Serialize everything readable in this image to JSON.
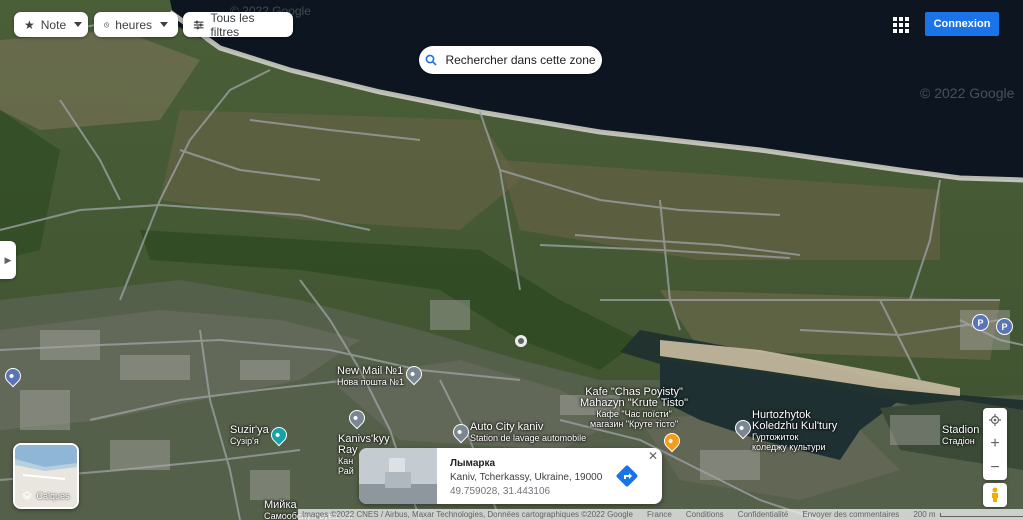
{
  "filters": {
    "note_label": "Note",
    "hours_label": "heures",
    "all_filters_label": "Tous les filtres"
  },
  "search_area_label": "Rechercher dans cette zone",
  "signin_label": "Connexion",
  "watermark": "© 2022 Google",
  "layers_label": "Calques",
  "map_labels": {
    "new_mail": "New Mail №1",
    "new_mail_sub": "Нова пошта №1",
    "kafe_1": "Kafe \"Chas Poyisty\"",
    "kafe_2": "Mahazyn \"Krute Tisto\"",
    "kafe_sub1": "Кафе \"Час поїсти\"",
    "kafe_sub2": "магазин \"Круте тісто\"",
    "hurtozhytok_1": "Hurtozhytok",
    "hurtozhytok_2": "Koledzhu Kul'tury",
    "hurtozhytok_sub1": "Гуртожиток",
    "hurtozhytok_sub2": "коледжу культури",
    "auto_city": "Auto City kaniv",
    "auto_city_sub": "Station de lavage automobile",
    "suziria": "Suzir'ya",
    "suziria_sub": "Сузір'я",
    "kanivs_kyy": "Kanivs'kyy",
    "kanivs_kyy_2": "Ray",
    "kanivs_kyy_3": "Кан",
    "kanivs_kyy_4": "Рай",
    "myika": "Мийка",
    "samoobsl": "Самообслуговування",
    "stadion": "Stadion",
    "stadion_sub": "Стадіон"
  },
  "place_card": {
    "title": "Лымарка",
    "address": "Kaniv, Tcherkassy, Ukraine, 19000",
    "coords": "49.759028, 31.443106"
  },
  "footer": {
    "attribution": "Images ©2022 CNES / Airbus, Maxar Technologies, Données cartographiques ©2022 Google",
    "country": "France",
    "terms": "Conditions",
    "privacy": "Confidentialité",
    "feedback": "Envoyer des commentaires",
    "scale": "200 m"
  },
  "colors": {
    "water": "#0d1520",
    "vegetation": "#4d6a34",
    "sand": "#c9bda2",
    "primary_blue": "#1a73e8",
    "pin_gray": "#7a8791",
    "pin_teal": "#17a2a8",
    "pin_orange": "#f29d1b",
    "parking_blue": "#5a75b5"
  }
}
